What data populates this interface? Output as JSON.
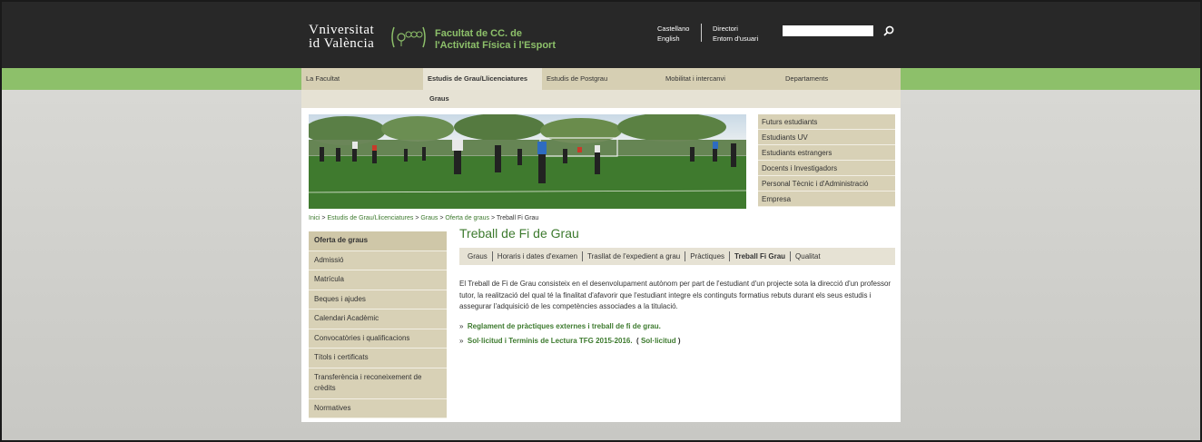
{
  "header": {
    "uv_line1": "Vniversitat",
    "uv_line2": "id València",
    "faculty_line1": "Facultat de CC. de",
    "faculty_line2": "l'Activitat Física i l'Esport",
    "languages": [
      "Castellano",
      "English"
    ],
    "utility_links": [
      "Directori",
      "Entorn d'usuari"
    ],
    "search": {
      "value": "",
      "icon": "search-icon"
    }
  },
  "topnav": [
    "La Facultat",
    "Estudis de Grau/Llicenciatures",
    "Estudis de Postgrau",
    "Mobilitat i intercanvi",
    "Departaments"
  ],
  "subnav": "Graus",
  "sidemenu": [
    "Futurs estudiants",
    "Estudiants UV",
    "Estudiants estrangers",
    "Docents i Investigadors",
    "Personal Tècnic i d'Administració",
    "Empresa"
  ],
  "breadcrumb": {
    "links": [
      "Inici",
      "Estudis de Grau/Llicenciatures",
      "Graus",
      "Oferta de graus"
    ],
    "separator": " > ",
    "current": "Treball Fi Grau"
  },
  "leftmenu": [
    "Oferta de graus",
    "Admissió",
    "Matrícula",
    "Beques i ajudes",
    "Calendari Acadèmic",
    "Convocatòries i qualificacions",
    "Títols i certificats",
    "Transferència i reconeixement de crèdits",
    "Normatives"
  ],
  "content": {
    "title": "Treball de Fi de Grau",
    "tabs": [
      "Graus",
      "Horaris i dates d'examen",
      "Trasllat de l'expedient a grau",
      "Pràctiques",
      "Treball Fi Grau",
      "Qualitat"
    ],
    "paragraph": "El Treball de Fi de Grau consisteix en el desenvolupament autònom per part de l'estudiant d'un projecte sota la direcció d'un professor tutor, la realització del qual té la finalitat d'afavorir que l'estudiant integre els continguts formatius rebuts durant els seus estudis i assegurar l'adquisició de les competències associades a la titulació.",
    "bullet": "»",
    "link1": "Reglament de pràctiques externes i treball de fi de grau.",
    "link2": "Sol·licitud i Terminis de Lectura TFG 2015-2016.",
    "link2_open": "(",
    "link2_extra": "Sol·licitud",
    "link2_close": ")"
  },
  "colors": {
    "header_bg": "#282828",
    "accent_green": "#8dc06a",
    "link_green": "#3d7a2e",
    "menu_beige": "#d8d1b6"
  }
}
